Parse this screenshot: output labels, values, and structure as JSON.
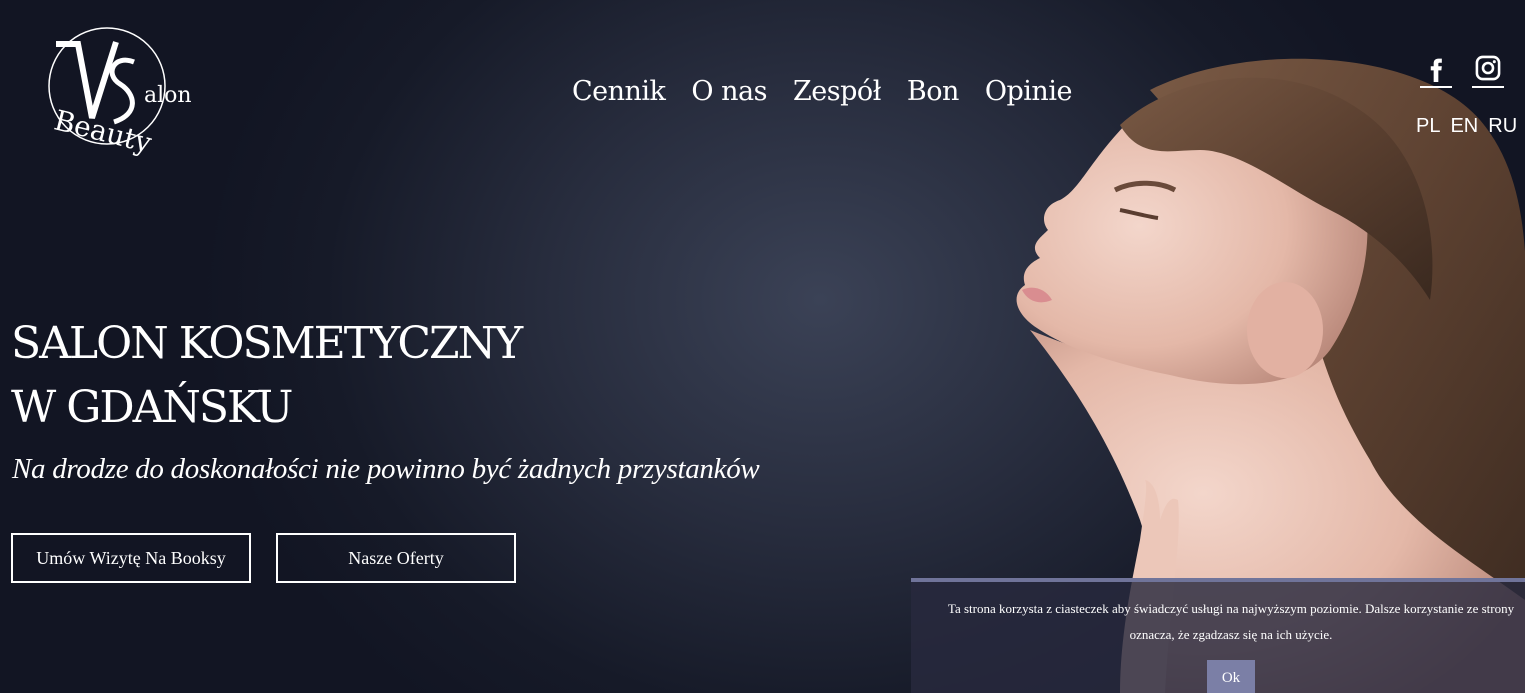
{
  "logo": {
    "monogram": "VS",
    "word_top": "alon",
    "word_bottom": "Beauty"
  },
  "nav": {
    "items": [
      {
        "label": "Cennik"
      },
      {
        "label": "O nas"
      },
      {
        "label": "Zespół"
      },
      {
        "label": "Bon"
      },
      {
        "label": "Opinie"
      }
    ]
  },
  "social": {
    "icons": [
      "facebook-icon",
      "instagram-icon"
    ]
  },
  "languages": [
    "PL",
    "EN",
    "RU"
  ],
  "hero": {
    "title_line1": "SALON KOSMETYCZNY",
    "title_line2": "W GDAŃSKU",
    "subtitle": "Na drodze do doskonałości nie powinno być żadnych przystanków",
    "button_booksy": "Umów Wizytę Na Booksy",
    "button_offers": "Nasze Oferty"
  },
  "cookie": {
    "text": "Ta strona korzysta z ciasteczek aby świadczyć usługi na najwyższym poziomie. Dalsze korzystanie ze strony oznacza, że zgadzasz się na ich użycie.",
    "ok_label": "Ok"
  },
  "colors": {
    "background_dark": "#161a28",
    "cookie_accent": "#70749a",
    "cookie_button": "#7b7fa6",
    "text": "#ffffff"
  }
}
